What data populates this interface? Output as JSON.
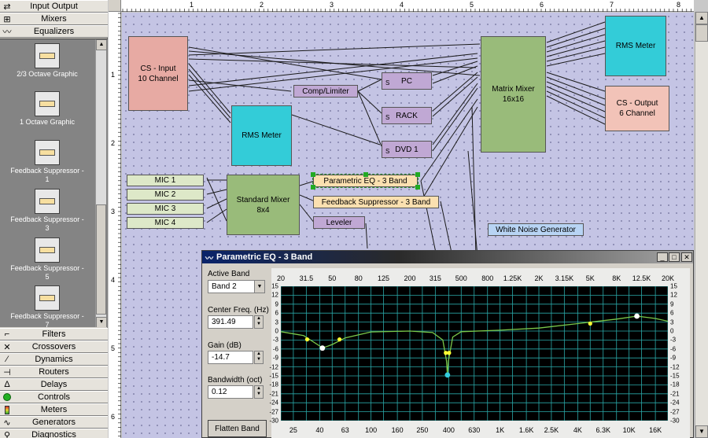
{
  "palette": {
    "categories_top": [
      {
        "label": "Input Output",
        "icon": "io-icon"
      },
      {
        "label": "Mixers",
        "icon": "mixer-icon"
      },
      {
        "label": "Equalizers",
        "icon": "wave-icon"
      }
    ],
    "items": [
      {
        "label": "2/3 Octave Graphic"
      },
      {
        "label": "1 Octave Graphic"
      },
      {
        "label": "Feedback Suppressor - 1"
      },
      {
        "label": "Feedback Suppressor - 3"
      },
      {
        "label": "Feedback Suppressor - 5"
      },
      {
        "label": "Feedback Suppressor - 7"
      }
    ],
    "categories_bottom": [
      {
        "label": "Filters",
        "icon": "filter-icon"
      },
      {
        "label": "Crossovers",
        "icon": "crossover-icon"
      },
      {
        "label": "Dynamics",
        "icon": "dynamics-icon"
      },
      {
        "label": "Routers",
        "icon": "router-icon"
      },
      {
        "label": "Delays",
        "icon": "delay-icon"
      },
      {
        "label": "Controls",
        "icon": "controls-icon"
      },
      {
        "label": "Meters",
        "icon": "meter-icon"
      },
      {
        "label": "Generators",
        "icon": "generator-icon"
      },
      {
        "label": "Diagnostics",
        "icon": "diagnostics-icon"
      }
    ]
  },
  "ruler": {
    "top": [
      "1",
      "2",
      "3",
      "4",
      "5",
      "6",
      "7",
      "8"
    ],
    "left": [
      "1",
      "2",
      "3",
      "4",
      "5",
      "6"
    ]
  },
  "canvas": {
    "cs_input": {
      "line1": "CS - Input",
      "line2": "10 Channel"
    },
    "comp_limiter": "Comp/Limiter",
    "pc": "PC",
    "rack": "RACK",
    "dvd": "DVD 1",
    "s_label": "S",
    "rms_meter_1": "RMS Meter",
    "rms_meter_2": "RMS Meter",
    "matrix_mixer": {
      "line1": "Matrix Mixer",
      "line2": "16x16"
    },
    "cs_output": {
      "line1": "CS - Output",
      "line2": "6 Channel"
    },
    "mics": [
      "MIC 1",
      "MIC 2",
      "MIC 3",
      "MIC 4"
    ],
    "standard_mixer": {
      "line1": "Standard Mixer",
      "line2": "8x4"
    },
    "parametric_eq": "Parametric EQ - 3 Band",
    "feedback_suppressor": "Feedback Suppressor - 3 Band",
    "leveler": "Leveler",
    "white_noise": "White Noise Generator"
  },
  "eq": {
    "title": "Parametric EQ - 3 Band",
    "active_band_label": "Active Band",
    "active_band_value": "Band 2",
    "center_freq_label": "Center Freq. (Hz)",
    "center_freq_value": "391.49",
    "gain_label": "Gain (dB)",
    "gain_value": "-14.7",
    "bandwidth_label": "Bandwidth (oct)",
    "bandwidth_value": "0.12",
    "flatten_label": "Flatten Band",
    "hz_top": [
      "20",
      "31.5",
      "50",
      "80",
      "125",
      "200",
      "315",
      "500",
      "800",
      "1.25K",
      "2K",
      "3.15K",
      "5K",
      "8K",
      "12.5K",
      "20K"
    ],
    "hz_bottom": [
      "25",
      "40",
      "63",
      "100",
      "160",
      "250",
      "400",
      "630",
      "1K",
      "1.6K",
      "2.5K",
      "4K",
      "6.3K",
      "10K",
      "16K"
    ],
    "db_ticks": [
      "15",
      "12",
      "9",
      "6",
      "3",
      "0",
      "-3",
      "-6",
      "-9",
      "-12",
      "-15",
      "-18",
      "-21",
      "-24",
      "-27",
      "-30"
    ],
    "colors": {
      "curve": "#7ac84a",
      "grid": "#2aa8a8",
      "band_point": "#ffffff",
      "handle": "#ffff33",
      "active": "#33ccdd"
    }
  },
  "chart_data": {
    "type": "line",
    "title": "",
    "xlabel": "",
    "ylabel": "",
    "x_scale": "log",
    "xlim": [
      20,
      20000
    ],
    "ylim": [
      -30,
      15
    ],
    "grid": true,
    "series": [
      {
        "x": [
          20,
          30,
          40,
          42,
          50,
          63,
          100,
          200,
          300,
          360,
          385,
          391.5,
          398,
          430,
          500,
          1000,
          2000,
          4000,
          8000,
          11500,
          16000,
          20000
        ],
        "y": [
          -0.2,
          -1.5,
          -5.0,
          -5.7,
          -4.5,
          -2.3,
          -0.3,
          0,
          -0.5,
          -3.0,
          -10.0,
          -14.7,
          -10.0,
          -2.0,
          -0.2,
          0.3,
          1.0,
          2.5,
          4.0,
          5.0,
          4.2,
          3.3
        ]
      }
    ],
    "band_points": [
      {
        "band": "Band 1",
        "x": 42,
        "y": -5.7
      },
      {
        "band": "Band 2",
        "x": 391.49,
        "y": -14.7
      },
      {
        "band": "Band 3",
        "x": 11500,
        "y": 5.0
      }
    ],
    "handles": [
      {
        "x": 32,
        "y": -2.8
      },
      {
        "x": 57,
        "y": -2.8
      },
      {
        "x": 380,
        "y": -7.3
      },
      {
        "x": 403,
        "y": -7.3
      },
      {
        "x": 5000,
        "y": 2.5
      }
    ]
  }
}
